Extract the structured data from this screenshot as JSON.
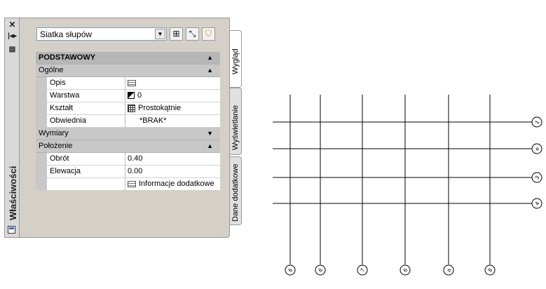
{
  "palette": {
    "title": "Właściwości",
    "strip_buttons": [
      "close-icon",
      "auto-hide-icon",
      "properties-menu-icon"
    ],
    "selector_value": "Siatka słupów",
    "toolbar_buttons": [
      "select-objects-icon",
      "quick-select-icon",
      "filter-icon"
    ],
    "grid": {
      "top_category": "PODSTAWOWY",
      "sections": [
        {
          "label": "Ogólne",
          "expanded": true,
          "rows": [
            {
              "name": "Opis",
              "value": "",
              "icon": "note-icon"
            },
            {
              "name": "Warstwa",
              "value": "0",
              "icon": "layer-icon"
            },
            {
              "name": "Kształt",
              "value": "Prostokątnie",
              "icon": "grid-shape-icon"
            },
            {
              "name": "Obwiednia",
              "value": "*BRAK*",
              "icon": ""
            }
          ]
        },
        {
          "label": "Wymiary",
          "expanded": false,
          "rows": []
        },
        {
          "label": "Położenie",
          "expanded": true,
          "rows": [
            {
              "name": "Obrót",
              "value": "0.40",
              "icon": ""
            },
            {
              "name": "Elewacja",
              "value": "0.00",
              "icon": ""
            },
            {
              "name": "",
              "value": "Informacje dodatkowe",
              "icon": "note-icon"
            }
          ]
        }
      ]
    },
    "tabs": [
      "Wygląd",
      "Wyświetlanie",
      "Dane dodatkowe"
    ],
    "active_tab": "Wygląd"
  },
  "drawing": {
    "row_bubble_labels": [
      "1",
      "e",
      "3",
      "4"
    ],
    "column_bubble_labels": [
      "6",
      "6",
      "7",
      "6",
      "a",
      "8"
    ],
    "line_color": "#000000"
  }
}
